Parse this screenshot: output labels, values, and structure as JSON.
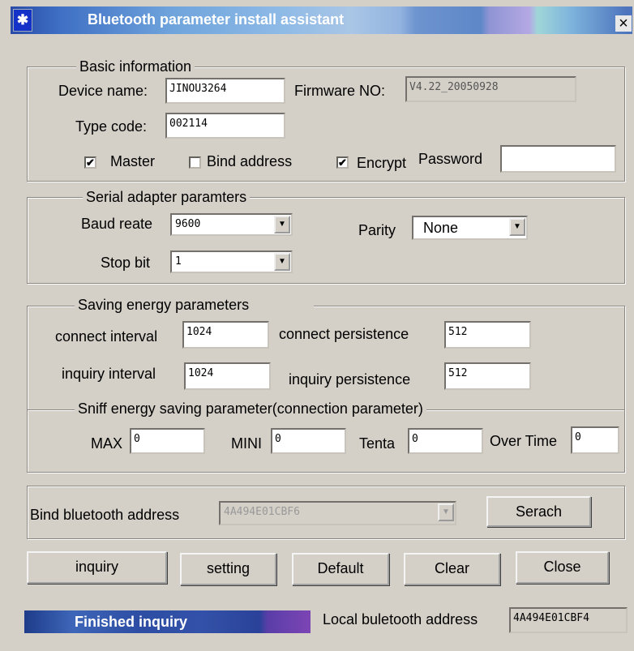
{
  "window": {
    "title": "Bluetooth parameter install assistant",
    "close_glyph": "×",
    "bt_glyph": "✱"
  },
  "basic": {
    "legend": "Basic information",
    "device_name_label": "Device name:",
    "device_name_value": "JINOU3264",
    "firmware_label": "Firmware NO:",
    "firmware_value": "V4.22_20050928",
    "type_code_label": "Type code:",
    "type_code_value": "002114",
    "master_label": "Master",
    "master_checked": true,
    "bind_address_label": "Bind address",
    "bind_address_checked": false,
    "encrypt_label": "Encrypt",
    "encrypt_checked": true,
    "password_label": "Password",
    "password_value": ""
  },
  "serial": {
    "legend": "Serial adapter paramters",
    "baud_label": "Baud reate",
    "baud_value": "9600",
    "parity_label": "Parity",
    "parity_value": "None",
    "stop_bit_label": "Stop bit",
    "stop_bit_value": "1"
  },
  "energy": {
    "legend": "Saving energy parameters",
    "connect_interval_label": "connect interval",
    "connect_interval_value": "1024",
    "connect_persistence_label": "connect persistence",
    "connect_persistence_value": "512",
    "inquiry_interval_label": "inquiry interval",
    "inquiry_interval_value": "1024",
    "inquiry_persistence_label": "inquiry persistence",
    "inquiry_persistence_value": "512"
  },
  "sniff": {
    "legend": "Sniff energy saving parameter(connection parameter)",
    "max_label": "MAX",
    "max_value": "0",
    "mini_label": "MINI",
    "mini_value": "0",
    "tenta_label": "Tenta",
    "tenta_value": "0",
    "overtime_label": "Over Time",
    "overtime_value": "0"
  },
  "bind": {
    "label": "Bind bluetooth address",
    "value": "4A494E01CBF6",
    "search_button": "Serach"
  },
  "buttons": {
    "inquiry": "inquiry",
    "setting": "setting",
    "default": "Default",
    "clear": "Clear",
    "close": "Close"
  },
  "status": {
    "text": "Finished inquiry",
    "local_address_label": "Local buletooth address",
    "local_address_value": "4A494E01CBF4"
  },
  "colors": {
    "dialog_bg": "#d4d0c8",
    "title_text": "#ffffff",
    "status_bar": "#2d4ea4"
  }
}
